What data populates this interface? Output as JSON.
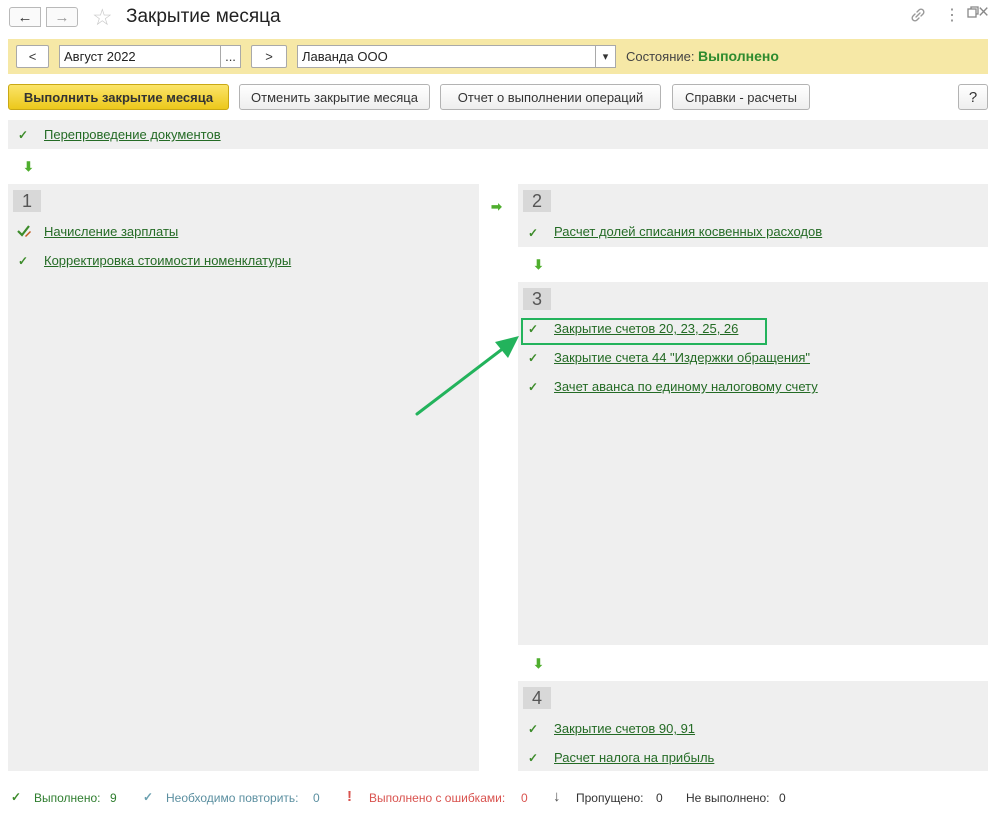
{
  "header": {
    "title": "Закрытие месяца",
    "back_icon": "←",
    "forward_icon": "→",
    "star_icon": "☆",
    "link_icon": "🔗",
    "more_icon": "⋮",
    "restore_icon": "□",
    "close_icon": "×"
  },
  "toolbar": {
    "prev_label": "<",
    "period_value": "Август 2022",
    "period_select_label": "...",
    "next_label": ">",
    "org_value": "Лаванда ООО",
    "org_dropdown_icon": "▾",
    "status_label": "Состояние:",
    "status_value": "Выполнено",
    "status_color": "#2e8b2e"
  },
  "actions": {
    "run_label": "Выполнить закрытие месяца",
    "cancel_label": "Отменить закрытие месяца",
    "report_label": "Отчет о выполнении операций",
    "reports_label": "Справки - расчеты",
    "help_label": "?"
  },
  "top_step": {
    "label": "Перепроведение документов",
    "down_arrow": "⬇"
  },
  "blocks": [
    {
      "number": "1",
      "items": [
        "Начисление зарплаты",
        "Корректировка стоимости номенклатуры"
      ]
    },
    {
      "number": "2",
      "items": [
        "Расчет долей списания косвенных расходов"
      ]
    },
    {
      "number": "3",
      "items": [
        "Закрытие счетов 20, 23, 25, 26",
        "Закрытие счета 44 \"Издержки обращения\"",
        "Зачет аванса по единому налоговому счету"
      ]
    },
    {
      "number": "4",
      "items": [
        "Закрытие счетов 90, 91",
        "Расчет налога на прибыль"
      ]
    }
  ],
  "connectors": {
    "right_arrow": "➡",
    "down_arrow": "⬇",
    "check_icon": "✓"
  },
  "status_bar": {
    "done_label": "Выполнено:",
    "done_count": "9",
    "repeat_label": "Необходимо повторить:",
    "repeat_count": "0",
    "errors_label": "Выполнено с ошибками:",
    "errors_count": "0",
    "skipped_label": "Пропущено:",
    "skipped_count": "0",
    "not_done_label": "Не выполнено:",
    "not_done_count": "0",
    "error_icon": "!",
    "skipped_icon": "↓"
  },
  "colors": {
    "accent_yellow": "#f6e8a6",
    "link_green": "#246b25",
    "highlight_green": "#23b35c",
    "error_red": "#d9534f",
    "repeat_teal": "#5b8fa0"
  }
}
